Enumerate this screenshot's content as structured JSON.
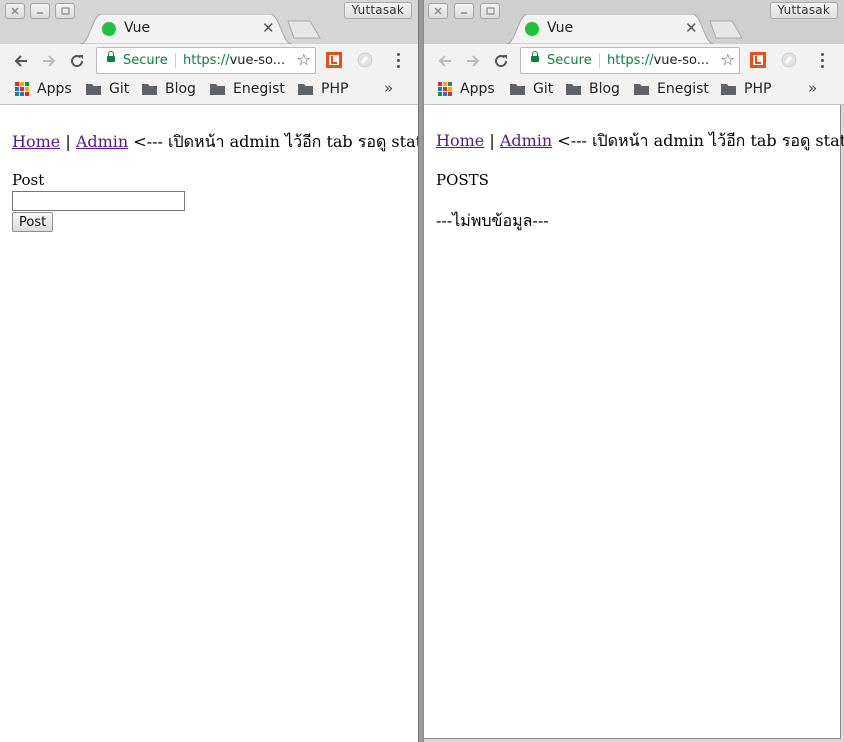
{
  "profile_name": "Yuttasak",
  "tab": {
    "title": "Vue"
  },
  "omnibox": {
    "secure_label": "Secure",
    "scheme": "https://",
    "host": "vue-so...",
    "separator": "|"
  },
  "bookmarks": [
    {
      "label": "Apps",
      "icon": "apps-grid-icon"
    },
    {
      "label": "Git",
      "icon": "folder-icon"
    },
    {
      "label": "Blog",
      "icon": "folder-icon"
    },
    {
      "label": "Enegist",
      "icon": "folder-icon"
    },
    {
      "label": "PHP",
      "icon": "folder-icon"
    }
  ],
  "bookmarks_overflow": "»",
  "page_nav": {
    "home": "Home",
    "divider": "|",
    "admin": "Admin",
    "note": "<--- เปิดหน้า admin ไว้อีก tab รอดู state"
  },
  "left_page": {
    "form_label": "Post",
    "input_value": "",
    "button_label": "Post"
  },
  "right_page": {
    "heading": "POSTS",
    "empty_message": "---ไม่พบข้อมูล---"
  },
  "colors": {
    "secure_green": "#0b8043",
    "favicon_green": "#1fc13a",
    "visited_link": "#551a8b"
  }
}
